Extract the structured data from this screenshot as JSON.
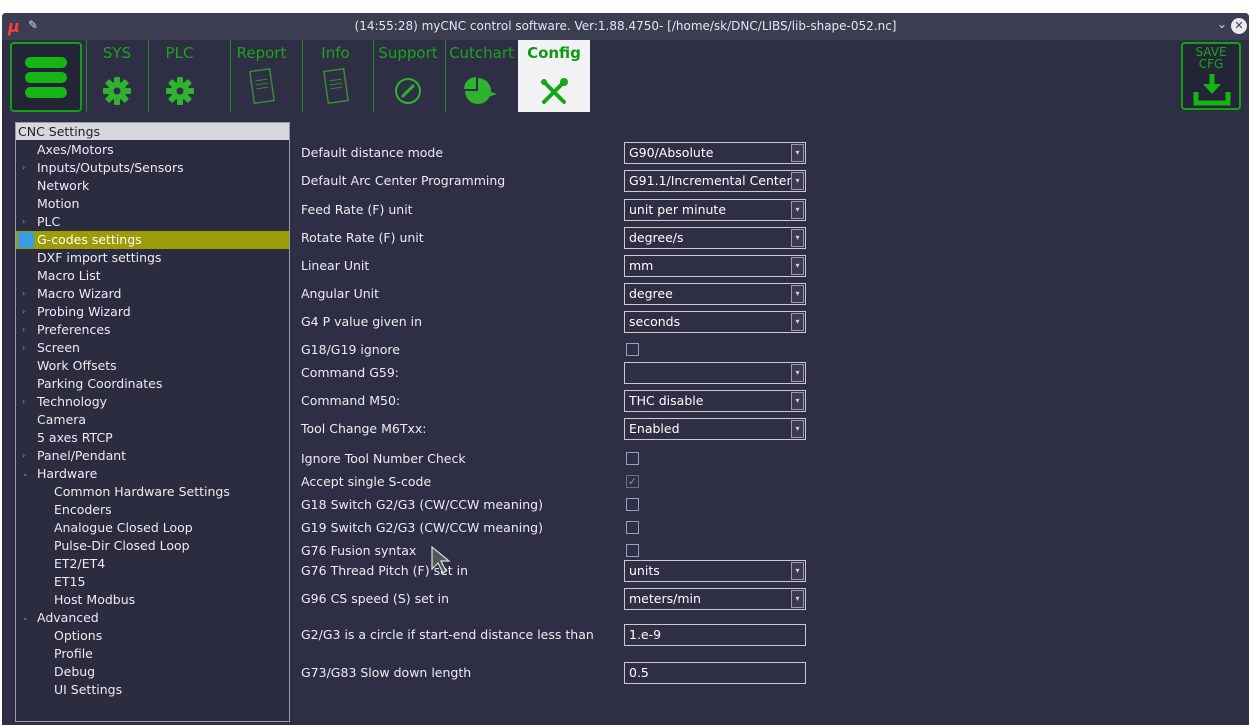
{
  "titlebar": {
    "title": "(14:55:28) myCNC control software. Ver:1.88.4750- [/home/sk/DNC/LIBS/lib-shape-052.nc]",
    "logo": "μ",
    "pin": "✎",
    "chevron": "⌄",
    "close": "✕"
  },
  "toolbar": {
    "tabs": [
      {
        "label": "SYS",
        "icon": "gear-icon"
      },
      {
        "label": "PLC",
        "icon": "gear-icon"
      },
      {
        "label": "Report",
        "icon": "document-icon"
      },
      {
        "label": "Info",
        "icon": "document-icon"
      },
      {
        "label": "Support",
        "icon": "phone-icon"
      },
      {
        "label": "Cutchart",
        "icon": "pie-icon"
      },
      {
        "label": "Config",
        "icon": "tools-icon"
      }
    ],
    "save_label_1": "SAVE",
    "save_label_2": "CFG"
  },
  "colors": {
    "accent": "#15b515",
    "selection": "#9b9c08",
    "background": "#2e2f44"
  },
  "tree": {
    "header": "CNC Settings",
    "items": [
      {
        "label": "Axes/Motors",
        "arrow": ""
      },
      {
        "label": "Inputs/Outputs/Sensors",
        "arrow": "›"
      },
      {
        "label": "Network",
        "arrow": ""
      },
      {
        "label": "Motion",
        "arrow": ""
      },
      {
        "label": "PLC",
        "arrow": "›"
      },
      {
        "label": "G-codes settings",
        "arrow": ""
      },
      {
        "label": "DXF import settings",
        "arrow": ""
      },
      {
        "label": "Macro List",
        "arrow": ""
      },
      {
        "label": "Macro Wizard",
        "arrow": "›"
      },
      {
        "label": "Probing Wizard",
        "arrow": "›"
      },
      {
        "label": "Preferences",
        "arrow": "›"
      },
      {
        "label": "Screen",
        "arrow": "›"
      },
      {
        "label": "Work Offsets",
        "arrow": ""
      },
      {
        "label": "Parking Coordinates",
        "arrow": ""
      },
      {
        "label": "Technology",
        "arrow": "›"
      },
      {
        "label": "Camera",
        "arrow": ""
      },
      {
        "label": "5 axes RTCP",
        "arrow": ""
      },
      {
        "label": "Panel/Pendant",
        "arrow": "›"
      },
      {
        "label": "Hardware",
        "arrow": "⌄"
      },
      {
        "label": "Common Hardware Settings",
        "arrow": ""
      },
      {
        "label": "Encoders",
        "arrow": ""
      },
      {
        "label": "Analogue Closed Loop",
        "arrow": ""
      },
      {
        "label": "Pulse-Dir Closed Loop",
        "arrow": ""
      },
      {
        "label": "ET2/ET4",
        "arrow": ""
      },
      {
        "label": "ET15",
        "arrow": ""
      },
      {
        "label": "Host Modbus",
        "arrow": ""
      },
      {
        "label": "Advanced",
        "arrow": "⌄"
      },
      {
        "label": "Options",
        "arrow": ""
      },
      {
        "label": "Profile",
        "arrow": ""
      },
      {
        "label": "Debug",
        "arrow": ""
      },
      {
        "label": "UI Settings",
        "arrow": ""
      }
    ]
  },
  "settings": [
    {
      "label": "Default distance mode",
      "type": "combo",
      "value": "G90/Absolute"
    },
    {
      "label": "Default Arc Center Programming",
      "type": "combo",
      "value": "G91.1/Incremental Center"
    },
    {
      "label": "Feed Rate (F) unit",
      "type": "combo",
      "value": "unit per minute"
    },
    {
      "label": "Rotate Rate (F) unit",
      "type": "combo",
      "value": "degree/s"
    },
    {
      "label": "Linear Unit",
      "type": "combo",
      "value": "mm"
    },
    {
      "label": "Angular Unit",
      "type": "combo",
      "value": "degree"
    },
    {
      "label": "G4 P value given in",
      "type": "combo",
      "value": "seconds"
    },
    {
      "label": "G18/G19 ignore",
      "type": "check",
      "checked": false
    },
    {
      "label": "Command G59:",
      "type": "combo",
      "value": ""
    },
    {
      "label": "Command M50:",
      "type": "combo",
      "value": "THC disable"
    },
    {
      "label": "Tool Change M6Txx:",
      "type": "combo",
      "value": "Enabled"
    },
    {
      "label": "Ignore Tool Number Check",
      "type": "check",
      "checked": false
    },
    {
      "label": "Accept single S-code",
      "type": "check",
      "checked": true
    },
    {
      "label": "G18 Switch G2/G3 (CW/CCW meaning)",
      "type": "check",
      "checked": false
    },
    {
      "label": "G19 Switch G2/G3 (CW/CCW meaning)",
      "type": "check",
      "checked": false
    },
    {
      "label": "G76 Fusion syntax",
      "type": "check",
      "checked": false
    },
    {
      "label": "G76 Thread Pitch (F) set in",
      "type": "combo",
      "value": "units"
    },
    {
      "label": "G96 CS speed (S) set in",
      "type": "combo",
      "value": "meters/min"
    },
    {
      "label": "G2/G3 is a circle if start-end distance less than",
      "type": "text",
      "value": "1.e-9"
    },
    {
      "label": "G73/G83 Slow down length",
      "type": "text",
      "value": "0.5"
    }
  ]
}
